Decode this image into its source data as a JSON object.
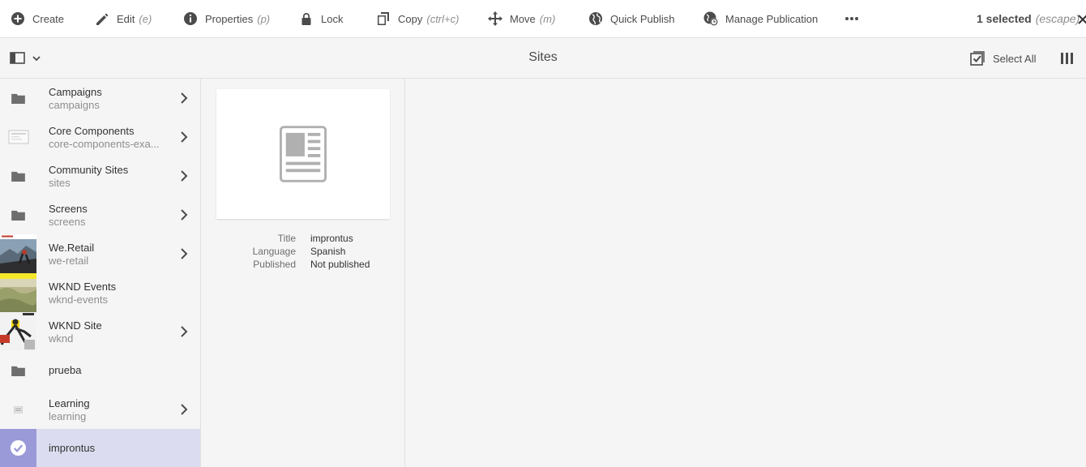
{
  "toolbar": {
    "actions": [
      {
        "label": "Create",
        "shortcut": "",
        "icon": "add-circle-icon"
      },
      {
        "label": "Edit",
        "shortcut": "(e)",
        "icon": "pencil-icon"
      },
      {
        "label": "Properties",
        "shortcut": "(p)",
        "icon": "info-icon"
      },
      {
        "label": "Lock",
        "shortcut": "",
        "icon": "lock-icon"
      },
      {
        "label": "Copy",
        "shortcut": "(ctrl+c)",
        "icon": "copy-icon"
      },
      {
        "label": "Move",
        "shortcut": "(m)",
        "icon": "move-icon"
      },
      {
        "label": "Quick Publish",
        "shortcut": "",
        "icon": "globe-icon"
      },
      {
        "label": "Manage Publication",
        "shortcut": "",
        "icon": "globe-clock-icon"
      }
    ],
    "more_icon": "more-icon",
    "selection_count": "1 selected",
    "selection_shortcut": "(escape)",
    "close_icon": "close-icon"
  },
  "subbar": {
    "title": "Sites",
    "select_all": "Select All",
    "rail_icon": "rail-toggle-icon",
    "view_icon": "column-view-icon"
  },
  "sites": [
    {
      "title": "Campaigns",
      "subtitle": "campaigns",
      "thumb": "folder",
      "has_children": true
    },
    {
      "title": "Core Components",
      "subtitle": "core-components-exa...",
      "thumb": "page-outline",
      "has_children": true
    },
    {
      "title": "Community Sites",
      "subtitle": "sites",
      "thumb": "folder",
      "has_children": true
    },
    {
      "title": "Screens",
      "subtitle": "screens",
      "thumb": "folder",
      "has_children": true
    },
    {
      "title": "We.Retail",
      "subtitle": "we-retail",
      "thumb": "photo-retail",
      "has_children": true
    },
    {
      "title": "WKND Events",
      "subtitle": "wknd-events",
      "thumb": "photo-events",
      "has_children": false
    },
    {
      "title": "WKND Site",
      "subtitle": "wknd",
      "thumb": "photo-wknd",
      "has_children": true
    },
    {
      "title": "prueba",
      "subtitle": "",
      "thumb": "folder",
      "has_children": false
    },
    {
      "title": "Learning",
      "subtitle": "learning",
      "thumb": "page-small",
      "has_children": true
    },
    {
      "title": "improntus",
      "subtitle": "",
      "thumb": "check",
      "has_children": false,
      "selected": true
    }
  ],
  "preview": {
    "icon": "page-layout-icon",
    "fields": [
      {
        "label": "Title",
        "value": "improntus"
      },
      {
        "label": "Language",
        "value": "Spanish"
      },
      {
        "label": "Published",
        "value": "Not published"
      }
    ]
  },
  "colors": {
    "selected_row": "#dcdcf0",
    "selected_thumb": "#9a9ad8",
    "icon": "#4b4b4b"
  }
}
